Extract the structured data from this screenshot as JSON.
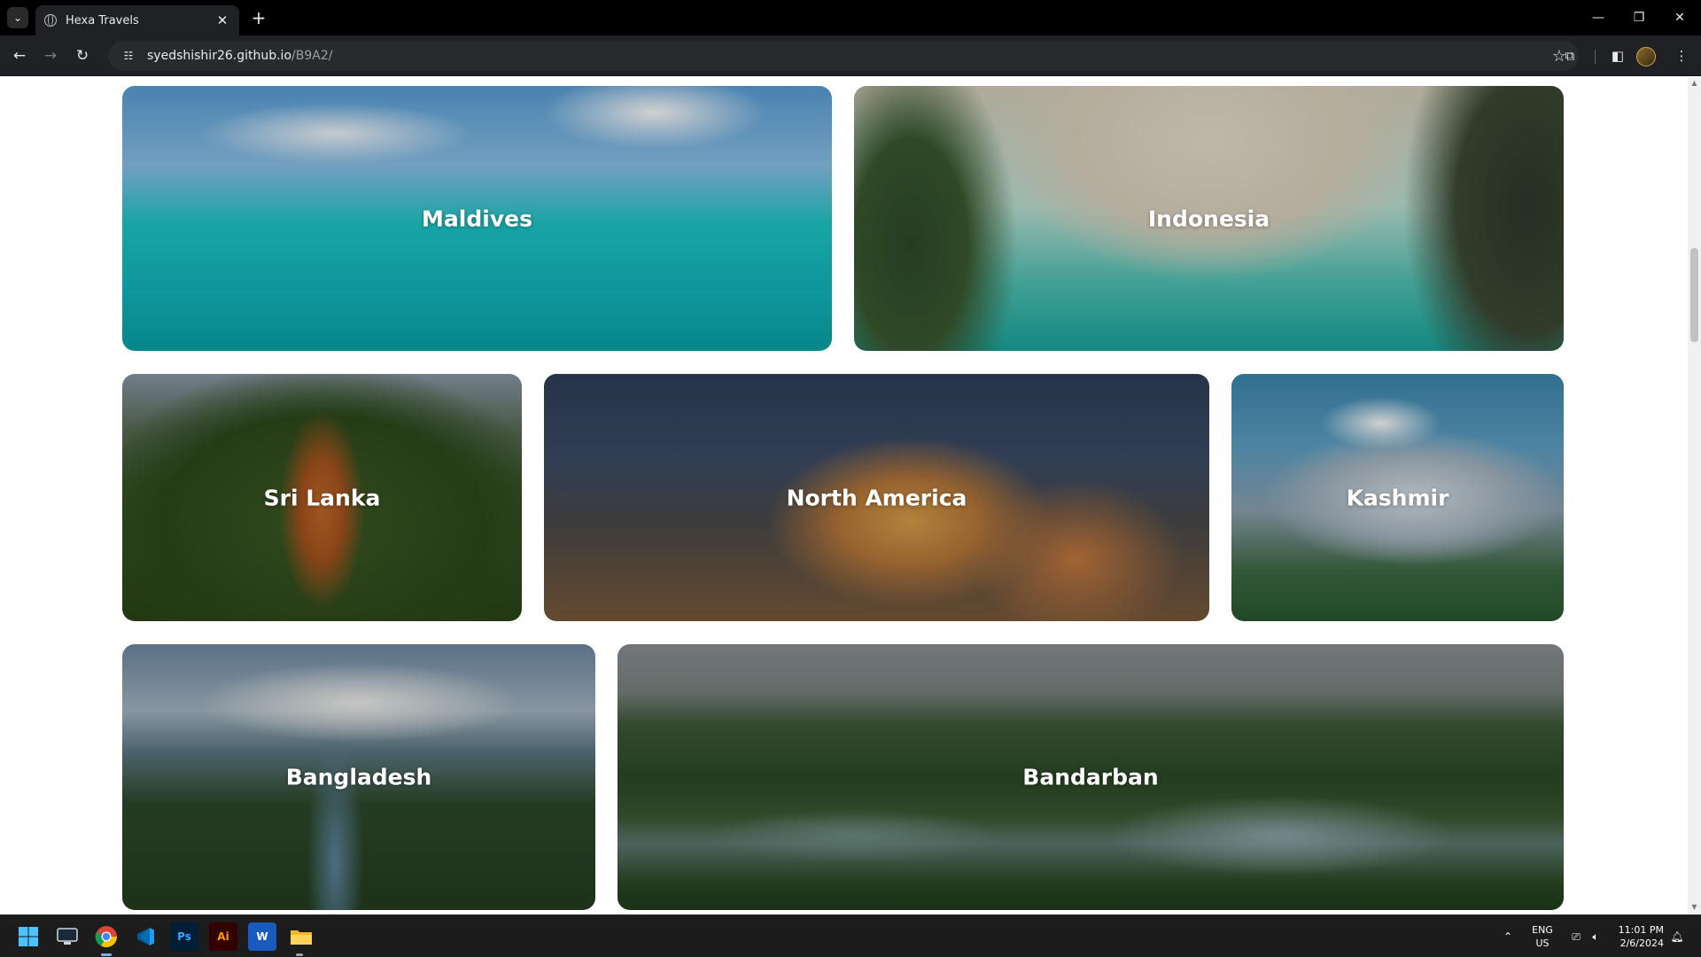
{
  "browser": {
    "tab_title": "Hexa Travels",
    "url_host": "syedshishir26.github.io",
    "url_path": "/B9A2/"
  },
  "destinations": [
    {
      "name": "Maldives"
    },
    {
      "name": "Indonesia"
    },
    {
      "name": "Sri Lanka"
    },
    {
      "name": "North America"
    },
    {
      "name": "Kashmir"
    },
    {
      "name": "Bangladesh"
    },
    {
      "name": "Bandarban"
    }
  ],
  "taskbar": {
    "apps": [
      "windows-start",
      "terminal",
      "chrome",
      "vscode",
      "photoshop",
      "illustrator",
      "word",
      "file-explorer"
    ],
    "ps_label": "Ps",
    "ai_label": "Ai",
    "word_label": "W",
    "lang_top": "ENG",
    "lang_bottom": "US",
    "time": "11:01 PM",
    "date": "2/6/2024"
  },
  "colors": {
    "chrome_dark": "#202124",
    "tabbar": "#000000",
    "taskbar": "#1c1c1c"
  }
}
